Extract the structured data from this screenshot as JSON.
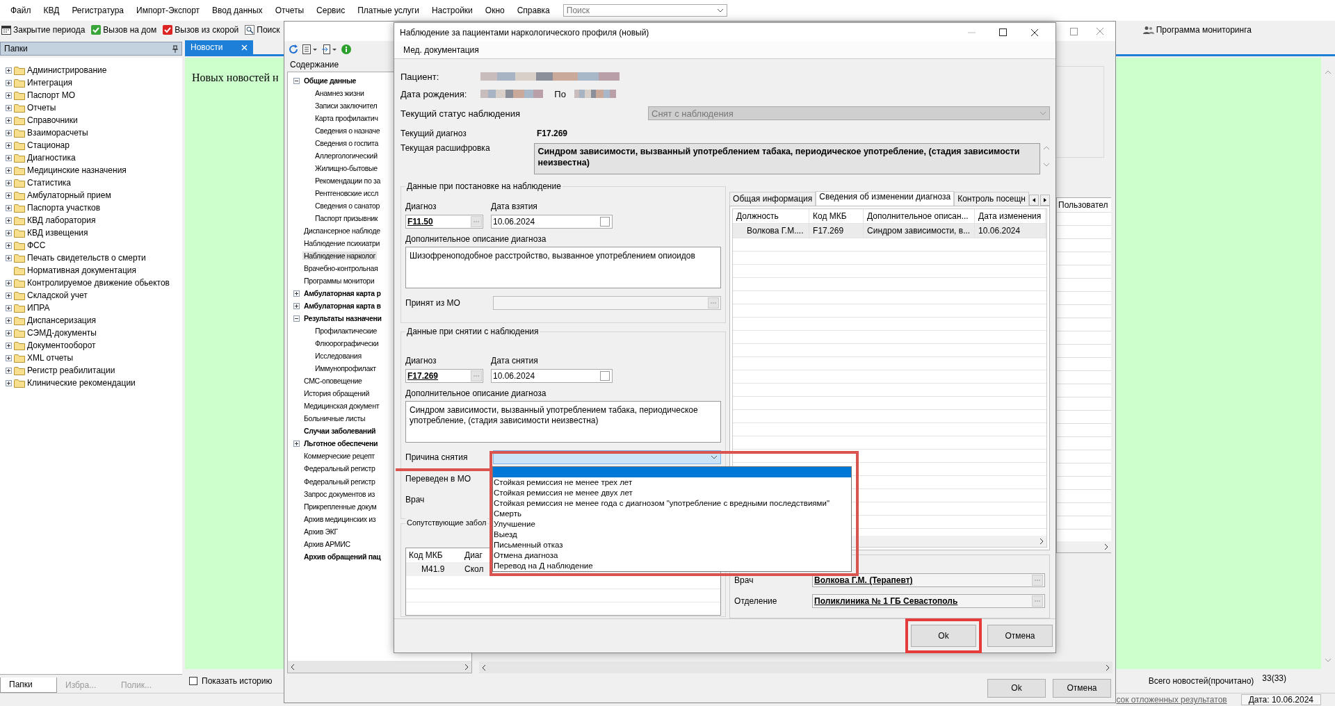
{
  "menu": [
    "Файл",
    "КВД",
    "Регистратура",
    "Импорт-Экспорт",
    "Ввод данных",
    "Отчеты",
    "Сервис",
    "Платные услуги",
    "Настройки",
    "Окно",
    "Справка"
  ],
  "search": {
    "placeholder": "Поиск"
  },
  "toolbar": [
    {
      "label": "Закрытие периода"
    },
    {
      "label": "Вызов на дом"
    },
    {
      "label": "Вызов из скорой"
    },
    {
      "label": "Поиск"
    }
  ],
  "toolbar_right": {
    "label": "Программа мониторинга"
  },
  "folders": {
    "title": "Папки",
    "items": [
      {
        "label": "Администрирование",
        "expandable": true
      },
      {
        "label": "Интеграция",
        "expandable": true
      },
      {
        "label": "Паспорт МО",
        "expandable": true
      },
      {
        "label": "Отчеты",
        "expandable": true
      },
      {
        "label": "Справочники",
        "expandable": true
      },
      {
        "label": "Взаиморасчеты",
        "expandable": true
      },
      {
        "label": "Стационар",
        "expandable": true
      },
      {
        "label": "Диагностика",
        "expandable": true
      },
      {
        "label": "Медицинские назначения",
        "expandable": true
      },
      {
        "label": "Статистика",
        "expandable": true
      },
      {
        "label": "Амбулаторный прием",
        "expandable": true
      },
      {
        "label": "Паспорта участков",
        "expandable": true
      },
      {
        "label": "КВД лаборатория",
        "expandable": true
      },
      {
        "label": "КВД извещения",
        "expandable": true
      },
      {
        "label": "ФСС",
        "expandable": true
      },
      {
        "label": "Печать свидетельств о смерти",
        "expandable": true
      },
      {
        "label": "Нормативная документация",
        "expandable": false
      },
      {
        "label": "Контролируемое движение обьектов",
        "expandable": true
      },
      {
        "label": "Складской учет",
        "expandable": true
      },
      {
        "label": "ИПРА",
        "expandable": true
      },
      {
        "label": "Диспансеризация",
        "expandable": true
      },
      {
        "label": "СЭМД-документы",
        "expandable": true
      },
      {
        "label": "Документооборот",
        "expandable": true
      },
      {
        "label": "XML отчеты",
        "expandable": true
      },
      {
        "label": "Регистр реабилитации",
        "expandable": true
      },
      {
        "label": "Клинические рекомендации",
        "expandable": true
      }
    ],
    "tabs": [
      {
        "label": "Папки",
        "selected": true
      },
      {
        "label": "Избра...",
        "selected": false
      },
      {
        "label": "Полик...",
        "selected": false
      }
    ]
  },
  "news": {
    "tab": {
      "label": "Новости",
      "selected": true
    },
    "message": "Новых новостей н",
    "show_history": {
      "label": "Показать историю",
      "checked": false
    },
    "total_label": "Всего новостей(прочитано)",
    "total": "33(33)"
  },
  "status_bar": {
    "link": "сок отложенных результатов",
    "date": "Дата: 10.06.2024"
  },
  "back_window": {
    "content_title": "Содержание",
    "tree": [
      {
        "label": "Общие данные",
        "bold": true,
        "selected": false,
        "expanded": true,
        "children": [
          {
            "label": "Анамнез жизни",
            "bold": false,
            "selected": false
          },
          {
            "label": "Записи заключител",
            "bold": false,
            "selected": false
          },
          {
            "label": "Карта профилактич",
            "bold": false,
            "selected": false
          },
          {
            "label": "Сведения о назначе",
            "bold": false,
            "selected": false
          },
          {
            "label": "Сведения о госпита",
            "bold": false,
            "selected": false
          },
          {
            "label": "Аллергологический",
            "bold": false,
            "selected": false
          },
          {
            "label": "Жилищно-бытовые",
            "bold": false,
            "selected": false
          },
          {
            "label": "Рекомендации по за",
            "bold": false,
            "selected": false
          },
          {
            "label": "Рентгеновские иссл",
            "bold": false,
            "selected": false
          },
          {
            "label": "Сведения о санатор",
            "bold": false,
            "selected": false
          },
          {
            "label": "Паспорт призывник",
            "bold": false,
            "selected": false
          }
        ]
      },
      {
        "label": "Диспансерное наблюде",
        "bold": false,
        "selected": false
      },
      {
        "label": "Наблюдение психиатри",
        "bold": false,
        "selected": false
      },
      {
        "label": "Наблюдение нарколог",
        "bold": false,
        "selected": true
      },
      {
        "label": "Врачебно-контрольная",
        "bold": false,
        "selected": false
      },
      {
        "label": "Программы монитори",
        "bold": false,
        "selected": false
      },
      {
        "label": "Амбулаторная карта р",
        "bold": true,
        "selected": false,
        "expanded": false
      },
      {
        "label": "Амбулаторная карта в",
        "bold": true,
        "selected": false,
        "expanded": false
      },
      {
        "label": "Результаты назначени",
        "bold": true,
        "selected": false,
        "expanded": true,
        "children": [
          {
            "label": "Профилактические",
            "bold": false,
            "selected": false
          },
          {
            "label": "Флюорографически",
            "bold": false,
            "selected": false
          },
          {
            "label": "Исследования",
            "bold": false,
            "selected": false
          },
          {
            "label": "Иммунопрофилакт",
            "bold": false,
            "selected": false
          }
        ]
      },
      {
        "label": "СМС-оповещение",
        "bold": false,
        "selected": false
      },
      {
        "label": "История обращений",
        "bold": false,
        "selected": false
      },
      {
        "label": "Медицинская документ",
        "bold": false,
        "selected": false
      },
      {
        "label": "Больничные листы",
        "bold": false,
        "selected": false
      },
      {
        "label": "Случаи заболеваний",
        "bold": true,
        "selected": false
      },
      {
        "label": "Льготное обеспечени",
        "bold": true,
        "selected": false,
        "expanded": false
      },
      {
        "label": "Коммерческие рецепт",
        "bold": false,
        "selected": false
      },
      {
        "label": "Федеральный регистр",
        "bold": false,
        "selected": false
      },
      {
        "label": "Федеральный регистр",
        "bold": false,
        "selected": false
      },
      {
        "label": "Запрос документов из",
        "bold": false,
        "selected": false
      },
      {
        "label": "Прикрепленные докум",
        "bold": false,
        "selected": false
      },
      {
        "label": "Архив медицинских из",
        "bold": false,
        "selected": false
      },
      {
        "label": "Архив ЭКГ",
        "bold": false,
        "selected": false
      },
      {
        "label": "Архив АРМИС",
        "bold": false,
        "selected": false
      },
      {
        "label": "Архив обращений пац",
        "bold": true,
        "selected": false
      }
    ],
    "column_header": "Пользовател",
    "buttons": [
      "Ok",
      "Отмена"
    ]
  },
  "dialog": {
    "title": "Наблюдение за пациентами наркологического профиля (новый)",
    "menu": [
      "Мед. документация"
    ],
    "patient_label": "Пациент:",
    "birth_label": "Дата рождения:",
    "gender_label": "По",
    "status": {
      "label": "Текущий статус наблюдения",
      "value": "Снят с наблюдения",
      "disabled": true
    },
    "diagnosis": {
      "label": "Текущий диагноз",
      "value": "F17.269"
    },
    "decoding": {
      "label": "Текущая расшифровка",
      "value": "Синдром зависимости, вызванный употреблением табака, периодическое употребление, (стадия зависимости неизвестна)"
    },
    "registration": {
      "title": "Данные при постановке на наблюдение",
      "diagnosis_label": "Диагноз",
      "diagnosis": "F11.50",
      "date_label": "Дата взятия",
      "date": "10.06.2024",
      "description_label": "Дополнительное описание диагноза",
      "description": "Шизофреноподобное расстройство, вызванное употреблением опиоидов",
      "from_mo_label": "Принят из МО"
    },
    "removal": {
      "title": "Данные при снятии с наблюдения",
      "diagnosis_label": "Диагноз",
      "diagnosis": "F17.269",
      "date_label": "Дата снятия",
      "date": "10.06.2024",
      "description_label": "Дополнительное описание диагноза",
      "description": "Синдром зависимости, вызванный употреблением табака, периодическое употребление, (стадия зависимости неизвестна)",
      "reason_label": "Причина снятия",
      "transferred_label": "Переведен в МО",
      "doctor_label": "Врач"
    },
    "reason_dropdown": {
      "annotated": true,
      "blank_option": {
        "selected": true
      },
      "options": [
        {
          "label": "Стойкая ремиссия не менее трех лет",
          "selected": false
        },
        {
          "label": "Стойкая ремиссия не менее двух лет",
          "selected": false
        },
        {
          "label": "Стойкая ремиссия не менее года с диагнозом \"употребление с вредными последствиями\"",
          "selected": false
        },
        {
          "label": "Смерть",
          "selected": false
        },
        {
          "label": "Улучшение",
          "selected": false
        },
        {
          "label": "Выезд",
          "selected": false
        },
        {
          "label": "Письменный отказ",
          "selected": false
        },
        {
          "label": "Отмена диагноза",
          "selected": false
        },
        {
          "label": "Перевод на Д наблюдение",
          "selected": false
        }
      ]
    },
    "comorbid": {
      "title": "Сопутствующие забол",
      "columns": [
        "Код МКБ",
        "Диаг"
      ],
      "rows": [
        [
          "M41.9",
          "Скол"
        ]
      ]
    },
    "history_tabs": [
      {
        "label": "Общая информация",
        "selected": false
      },
      {
        "label": "Сведения об изменении диагноза",
        "selected": true
      },
      {
        "label": "Контроль посещн",
        "selected": false
      }
    ],
    "history_table": {
      "columns": [
        "Должность",
        "Код МКБ",
        "Дополнительное описан...",
        "Дата изменения"
      ],
      "rows": [
        [
          "Волкова Г.М....",
          "F17.269",
          "Синдром зависимости, в...",
          "10.06.2024"
        ]
      ]
    },
    "doctor": {
      "label": "Врач",
      "value": "Волкова Г.М. (Терапевт)"
    },
    "department": {
      "label": "Отделение",
      "value": "Поликлиника № 1 ГБ Севастополь"
    },
    "buttons": [
      {
        "label": "Ok",
        "annotated": true
      },
      {
        "label": "Отмена",
        "annotated": false
      }
    ]
  }
}
